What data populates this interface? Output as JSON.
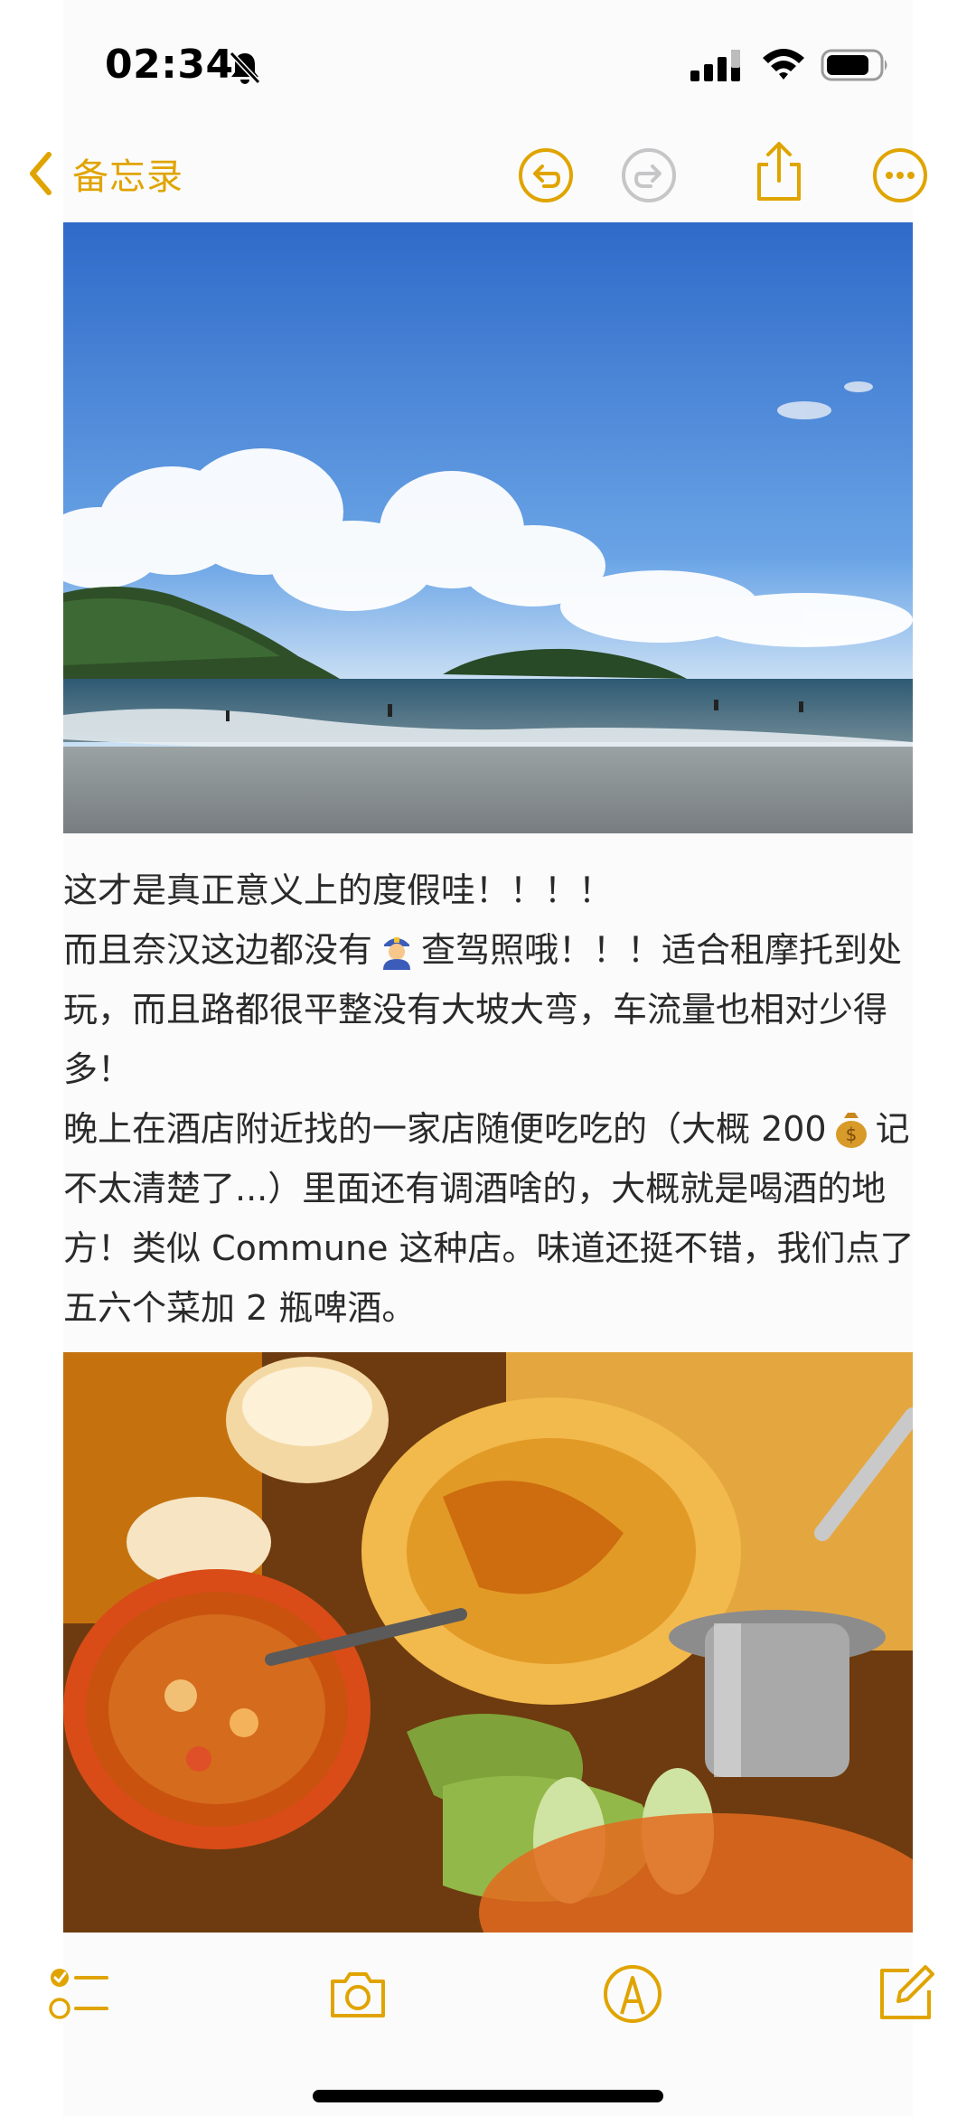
{
  "status_bar": {
    "time": "02:34",
    "icons": [
      "bell-slash-icon",
      "cellular-signal-icon",
      "wifi-icon",
      "battery-icon"
    ]
  },
  "nav": {
    "back_label": "备忘录",
    "actions": [
      "undo-icon",
      "redo-icon",
      "share-icon",
      "more-icon"
    ],
    "accent_color": "#e0a400",
    "disabled_color": "#c6c6c8"
  },
  "note": {
    "images": [
      {
        "description_icon": "photo-beach"
      },
      {
        "description_icon": "photo-food"
      }
    ],
    "paragraphs": [
      "这才是真正意义上的度假哇！！！！",
      "而且奈汉这边都没有",
      "查驾照哦！！！适合租摩托到处玩，而且路都很平整没有大坡大弯，车流量也相对少得多！",
      "晚上在酒店附近找的一家店随便吃吃的（大概 200",
      "记不太清楚了...）里面还有调酒啥的，大概就是喝酒的地方！类似 Commune 这种店。味道还挺不错，我们点了五六个菜加 2 瓶啤酒。"
    ],
    "emojis": [
      "police-officer-emoji",
      "money-bag-emoji"
    ]
  },
  "toolbar": {
    "items": [
      "checklist-icon",
      "camera-icon",
      "markup-icon",
      "compose-icon"
    ]
  }
}
